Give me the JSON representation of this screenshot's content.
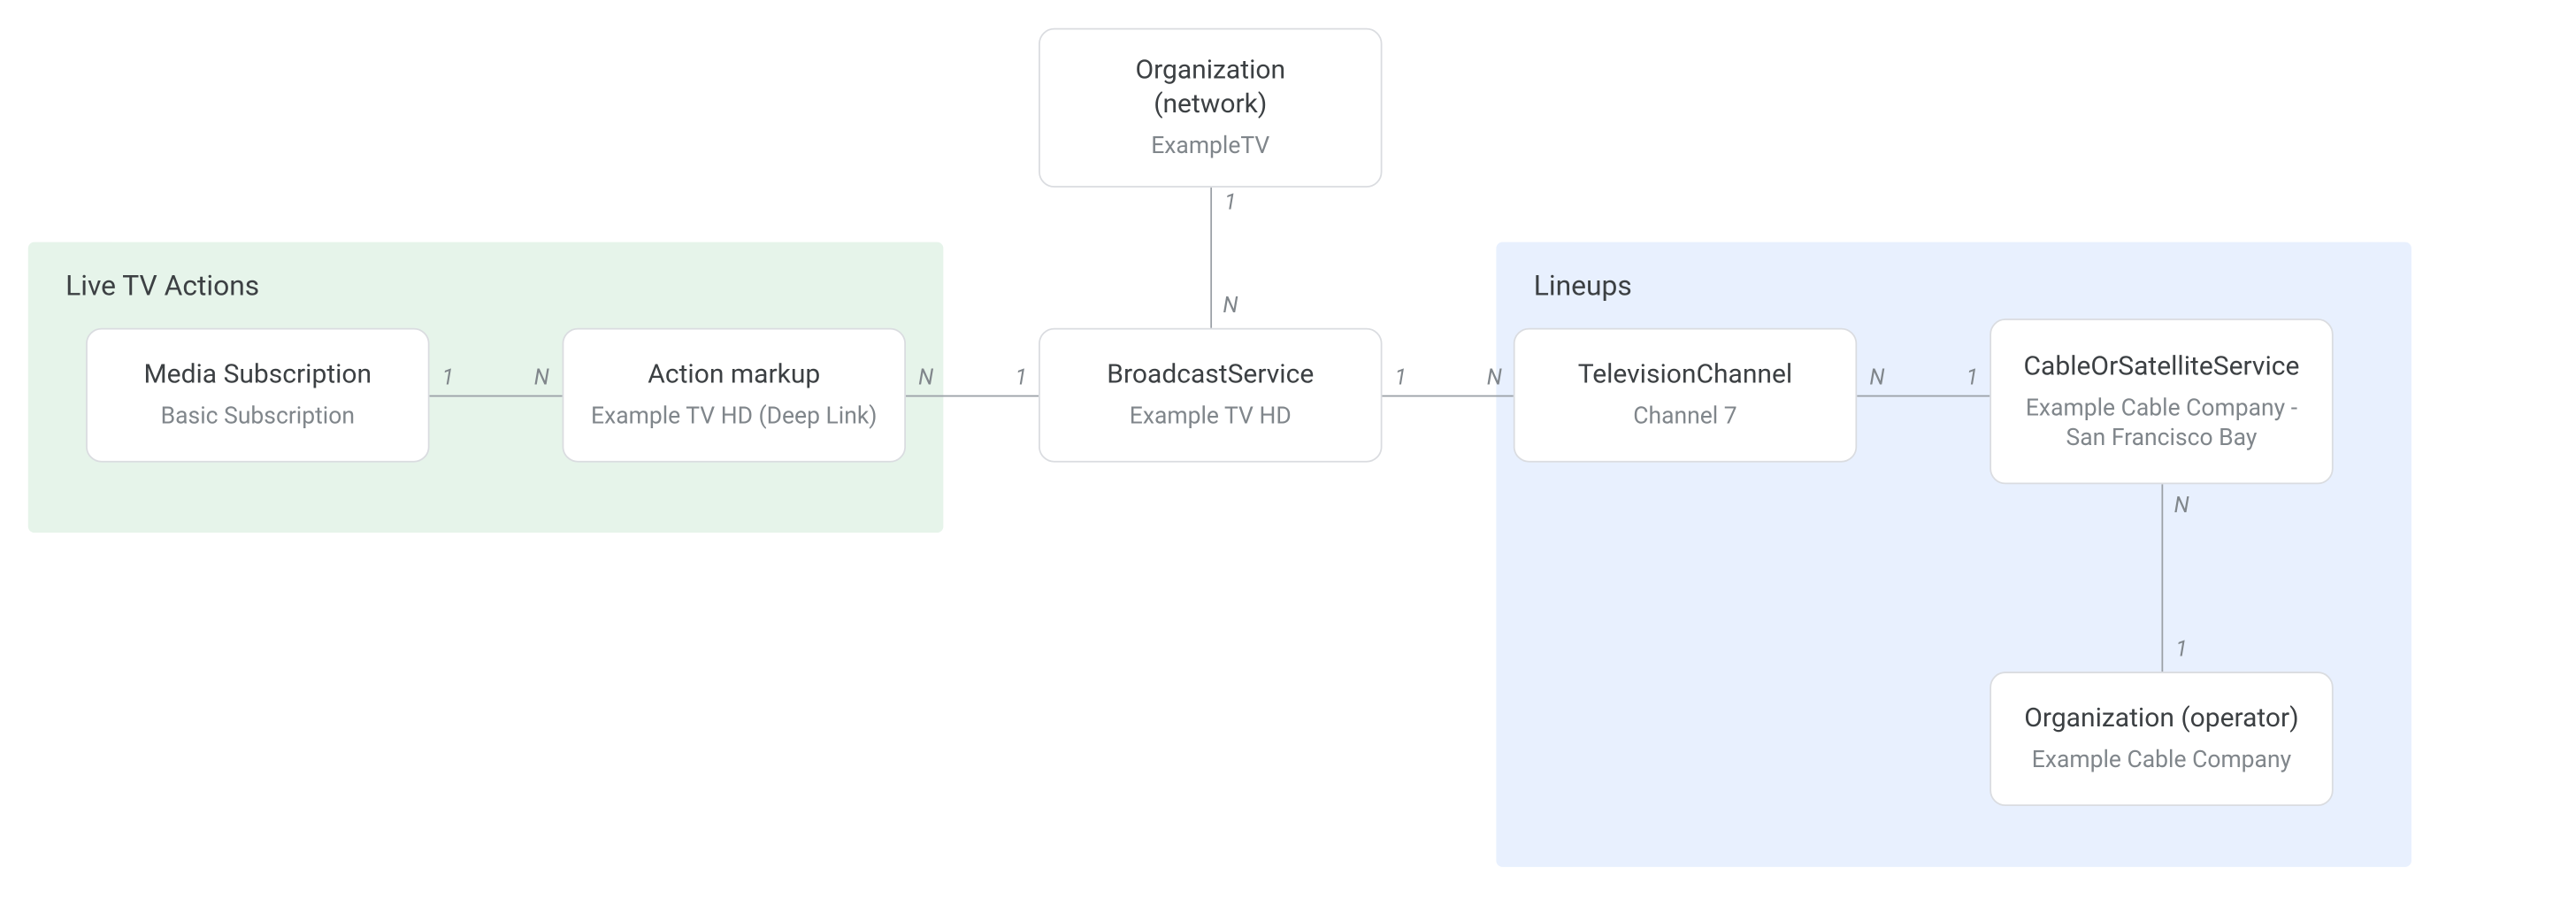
{
  "groups": {
    "live_tv": {
      "title": "Live TV Actions"
    },
    "lineups": {
      "title": "Lineups"
    }
  },
  "nodes": {
    "org_network": {
      "title_line1": "Organization",
      "title_line2": "(network)",
      "subtitle": "ExampleTV"
    },
    "media_sub": {
      "title": "Media Subscription",
      "subtitle": "Basic Subscription"
    },
    "action": {
      "title": "Action markup",
      "subtitle": "Example TV HD (Deep Link)"
    },
    "broadcast": {
      "title": "BroadcastService",
      "subtitle": "Example TV HD"
    },
    "tv_channel": {
      "title": "TelevisionChannel",
      "subtitle": "Channel 7"
    },
    "cable": {
      "title": "CableOrSatelliteService",
      "subtitle_line1": "Example Cable Company -",
      "subtitle_line2": "San Francisco Bay"
    },
    "org_operator": {
      "title": "Organization (operator)",
      "subtitle": "Example Cable Company"
    }
  },
  "cardinality": {
    "one": "1",
    "many": "N"
  }
}
